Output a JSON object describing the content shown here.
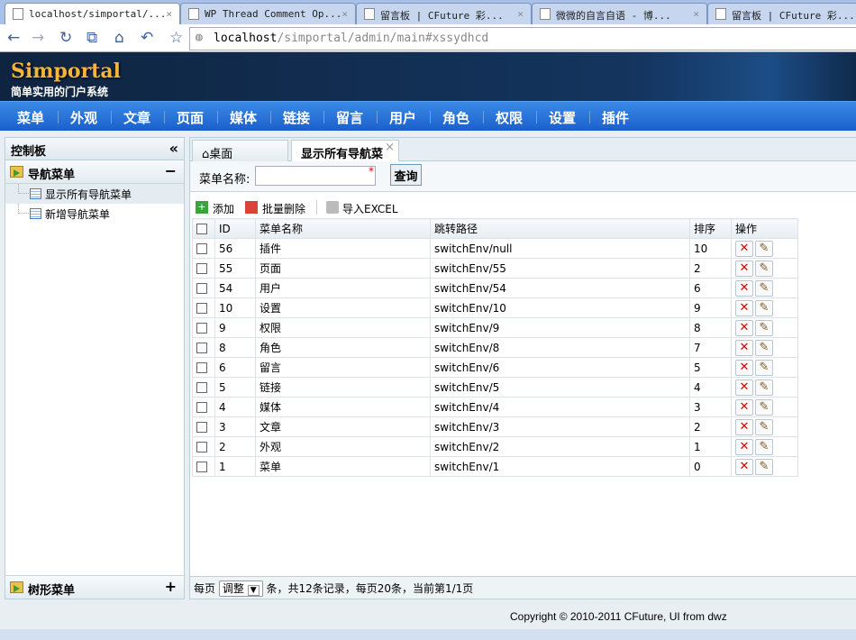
{
  "browser": {
    "tabs": [
      {
        "title": "localhost/simportal/...",
        "active": true
      },
      {
        "title": "WP Thread Comment Op...",
        "active": false
      },
      {
        "title": "留言板 | CFuture 彩...",
        "active": false
      },
      {
        "title": "微微的自言自语 - 博...",
        "active": false
      },
      {
        "title": "留言板 | CFuture 彩...",
        "active": false
      }
    ],
    "url_host": "localhost",
    "url_rest": "/simportal/admin/main#xssydhcd"
  },
  "header": {
    "logo": "Simportal",
    "slogan": "简单实用的门户系统"
  },
  "nav": [
    "菜单",
    "外观",
    "文章",
    "页面",
    "媒体",
    "链接",
    "留言",
    "用户",
    "角色",
    "权限",
    "设置",
    "插件"
  ],
  "sidebar": {
    "title": "控制板",
    "section": "导航菜单",
    "items": [
      "显示所有导航菜单",
      "新增导航菜单"
    ],
    "bottom_section": "树形菜单"
  },
  "content": {
    "tabs": [
      "桌面",
      "显示所有导航菜"
    ],
    "search_label": "菜单名称:",
    "search_value": "",
    "search_button": "查询",
    "toolbar": {
      "add": "添加",
      "batch_delete": "批量删除",
      "import": "导入EXCEL"
    },
    "columns": [
      "ID",
      "菜单名称",
      "跳转路径",
      "排序",
      "操作"
    ],
    "rows": [
      {
        "id": "56",
        "name": "插件",
        "path": "switchEnv/null",
        "order": "10"
      },
      {
        "id": "55",
        "name": "页面",
        "path": "switchEnv/55",
        "order": "2"
      },
      {
        "id": "54",
        "name": "用户",
        "path": "switchEnv/54",
        "order": "6"
      },
      {
        "id": "10",
        "name": "设置",
        "path": "switchEnv/10",
        "order": "9"
      },
      {
        "id": "9",
        "name": "权限",
        "path": "switchEnv/9",
        "order": "8"
      },
      {
        "id": "8",
        "name": "角色",
        "path": "switchEnv/8",
        "order": "7"
      },
      {
        "id": "6",
        "name": "留言",
        "path": "switchEnv/6",
        "order": "5"
      },
      {
        "id": "5",
        "name": "链接",
        "path": "switchEnv/5",
        "order": "4"
      },
      {
        "id": "4",
        "name": "媒体",
        "path": "switchEnv/4",
        "order": "3"
      },
      {
        "id": "3",
        "name": "文章",
        "path": "switchEnv/3",
        "order": "2"
      },
      {
        "id": "2",
        "name": "外观",
        "path": "switchEnv/2",
        "order": "1"
      },
      {
        "id": "1",
        "name": "菜单",
        "path": "switchEnv/1",
        "order": "0"
      }
    ],
    "pager": {
      "prefix": "每页",
      "select": "调整",
      "suffix": "条，共12条记录，每页20条，当前第1/1页"
    }
  },
  "copyright": "Copyright © 2010-2011 CFuture, UI from dwz"
}
